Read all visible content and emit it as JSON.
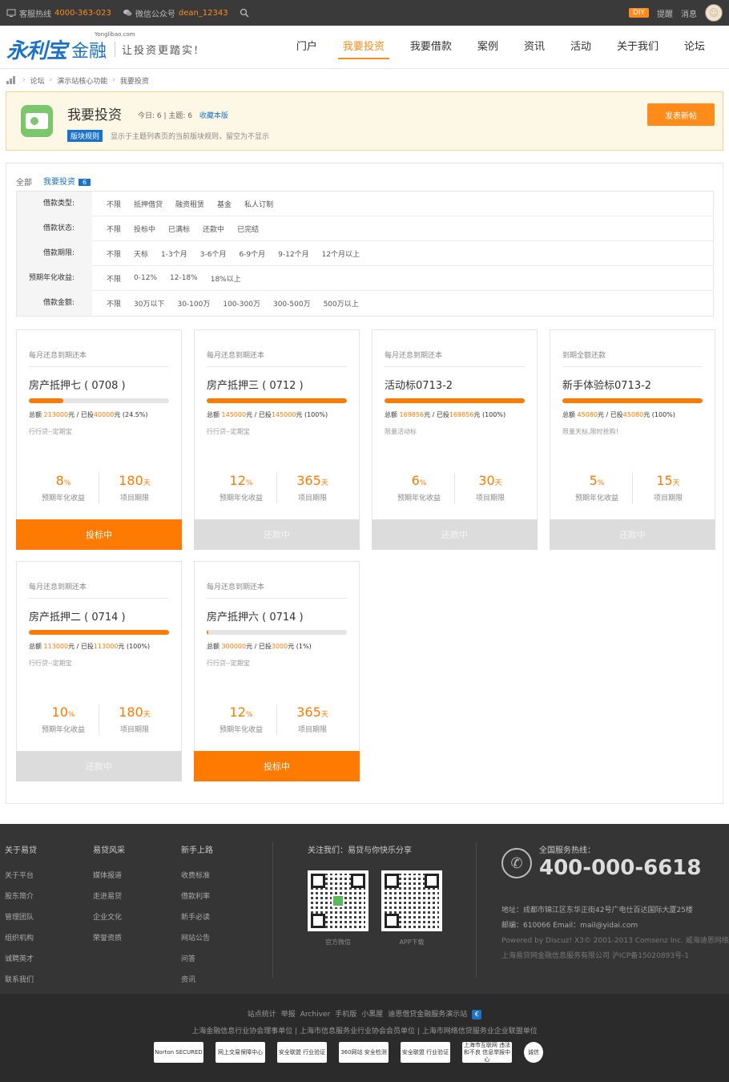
{
  "topbar": {
    "hotline_label": "客服热线",
    "hotline": "4000-363-023",
    "wechat_label": "微信公众号",
    "wechat": "dean_12343",
    "diy": "DIY",
    "remind": "提醒",
    "message": "消息"
  },
  "logo": {
    "brand": "永利宝",
    "site": "Yonglibao.com",
    "jr": "金融",
    "slogan": "让投资更踏实!"
  },
  "nav": [
    "门户",
    "我要投资",
    "我要借款",
    "案例",
    "资讯",
    "活动",
    "关于我们",
    "论坛"
  ],
  "breadcrumb": [
    "论坛",
    "演示站核心功能",
    "我要投资"
  ],
  "forum": {
    "title": "我要投资",
    "today": "今日: 6",
    "sep": "|",
    "topics": "主题: 6",
    "fav": "收藏本版",
    "rule_badge": "版块规则",
    "rule_text": "显示于主题列表页的当前版块规则，留空为不显示",
    "new_post": "发表新帖"
  },
  "tabs": {
    "all": "全部",
    "invest": "我要投资",
    "count": "6"
  },
  "filters": [
    {
      "label": "借款类型:",
      "options": [
        "不限",
        "抵押借贷",
        "融资租赁",
        "基金",
        "私人订制"
      ]
    },
    {
      "label": "借款状态:",
      "options": [
        "不限",
        "投标中",
        "已满标",
        "还款中",
        "已完结"
      ]
    },
    {
      "label": "借款期限:",
      "options": [
        "不限",
        "天标",
        "1-3个月",
        "3-6个月",
        "6-9个月",
        "9-12个月",
        "12个月以上"
      ]
    },
    {
      "label": "预期年化收益:",
      "options": [
        "不限",
        "0-12%",
        "12-18%",
        "18%以上"
      ]
    },
    {
      "label": "借款金额:",
      "options": [
        "不限",
        "30万以下",
        "30-100万",
        "100-300万",
        "300-500万",
        "500万以上"
      ]
    }
  ],
  "cards": [
    {
      "type": "每月还息到期还本",
      "name": "房产抵押七 ( 0708 )",
      "progress": 24.5,
      "total": "213000",
      "invested": "40000",
      "pct": "(24.5%)",
      "note": "行行贷--定期宝",
      "rate": "8",
      "rate_unit": "%",
      "rate_label": "预期年化收益",
      "term": "180",
      "term_unit": "天",
      "term_label": "项目期限",
      "button": "投标中",
      "active": true
    },
    {
      "type": "每月还息到期还本",
      "name": "房产抵押三 ( 0712 )",
      "progress": 100,
      "total": "145000",
      "invested": "145000",
      "pct": "(100%)",
      "note": "行行贷--定期宝",
      "rate": "12",
      "rate_unit": "%",
      "rate_label": "预期年化收益",
      "term": "365",
      "term_unit": "天",
      "term_label": "项目期限",
      "button": "还款中",
      "active": false
    },
    {
      "type": "每月还息到期还本",
      "name": "活动标0713-2",
      "progress": 100,
      "total": "169856",
      "invested": "169856",
      "pct": "(100%)",
      "note": "限量活动标",
      "rate": "6",
      "rate_unit": "%",
      "rate_label": "预期年化收益",
      "term": "30",
      "term_unit": "天",
      "term_label": "项目期限",
      "button": "还款中",
      "active": false
    },
    {
      "type": "到期全额还款",
      "name": "新手体验标0713-2",
      "progress": 100,
      "total": "45080",
      "invested": "45080",
      "pct": "(100%)",
      "note": "限量天标,限时抢购！",
      "rate": "5",
      "rate_unit": "%",
      "rate_label": "预期年化收益",
      "term": "15",
      "term_unit": "天",
      "term_label": "项目期限",
      "button": "还款中",
      "active": false
    },
    {
      "type": "每月还息到期还本",
      "name": "房产抵押二 ( 0714 )",
      "progress": 100,
      "total": "113000",
      "invested": "113000",
      "pct": "(100%)",
      "note": "行行贷--定期宝",
      "rate": "10",
      "rate_unit": "%",
      "rate_label": "预期年化收益",
      "term": "180",
      "term_unit": "天",
      "term_label": "项目期限",
      "button": "还款中",
      "active": false
    },
    {
      "type": "每月还息到期还本",
      "name": "房产抵押六 ( 0714 )",
      "progress": 1,
      "total": "300000",
      "invested": "3000",
      "pct": "(1%)",
      "note": "行行贷--定期宝",
      "rate": "12",
      "rate_unit": "%",
      "rate_label": "预期年化收益",
      "term": "365",
      "term_unit": "天",
      "term_label": "项目期限",
      "button": "投标中",
      "active": true
    }
  ],
  "card_text": {
    "total_label": "总额",
    "yuan": "元",
    "invested_label": " / 已投"
  },
  "footer": {
    "cols": [
      {
        "title": "关于易贷",
        "links": [
          "关于平台",
          "股东简介",
          "管理团队",
          "组织机构",
          "诚聘英才",
          "联系我们"
        ]
      },
      {
        "title": "易贷风采",
        "links": [
          "媒体报道",
          "走进易贷",
          "企业文化",
          "荣誉资质"
        ]
      },
      {
        "title": "新手上路",
        "links": [
          "收费标准",
          "借款利率",
          "新手必读",
          "网站公告",
          "问答",
          "资讯"
        ]
      }
    ],
    "follow": "关注我们：易贷与你快乐分享",
    "qr1": "官方微信",
    "qr2": "APP下载",
    "hotline_label": "全国服务热线：",
    "hotline": "400-000-6618",
    "address": "地址：成都市锦江区东华正街42号广电仕百达国际大厦25楼",
    "contact": "邮编：610066 Email：mail@yidai.com",
    "powered": "Powered by Discuz! X3© 2001-2013 Comsenz Inc. 威海迪恩网络",
    "icp": "上海易贷网金融信息服务有限公司 沪ICP备15020893号-1"
  },
  "footer2": {
    "links": [
      "站点统计",
      "举报",
      "Archiver",
      "手机版",
      "小黑屋",
      "迪恩借贷金融服务演示站"
    ],
    "line": "上海金融信息行业协会理事单位 | 上海市信息服务业行业协会会员单位 | 上海市网络信贷服务业企业联盟单位",
    "badges": [
      "Norton SECURED",
      "网上交易保障中心",
      "安全联盟 行业验证",
      "360网站 安全检测",
      "安全联盟 行业验证",
      "上海市互联网 违法和不良 信息举报中心",
      "诚信"
    ]
  },
  "colors": {
    "accent": "#ff7a00",
    "brand": "#1a73c8"
  }
}
